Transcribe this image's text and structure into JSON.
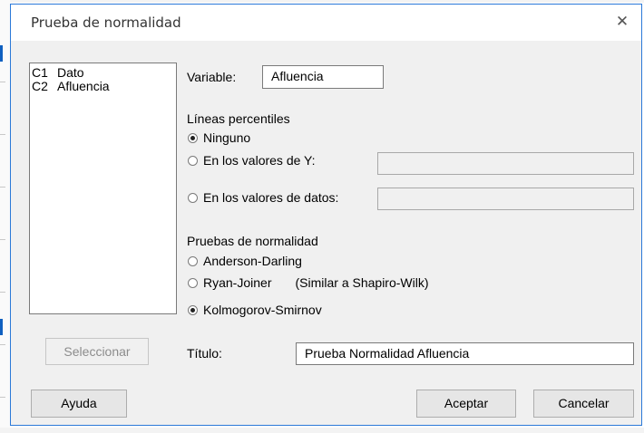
{
  "dialog": {
    "title": "Prueba de normalidad",
    "close_icon": "close-icon"
  },
  "variables": [
    {
      "id": "C1",
      "name": "Dato"
    },
    {
      "id": "C2",
      "name": "Afluencia"
    }
  ],
  "variable_field": {
    "label": "Variable:",
    "value": "Afluencia"
  },
  "percentile_lines": {
    "heading": "Líneas percentiles",
    "options": [
      {
        "label": "Ninguno",
        "selected": true
      },
      {
        "label": "En los valores de Y:",
        "selected": false
      },
      {
        "label": "En los valores de datos:",
        "selected": false
      }
    ],
    "y_values": "",
    "data_values": ""
  },
  "normality_tests": {
    "heading": "Pruebas de normalidad",
    "options": [
      {
        "label": "Anderson-Darling",
        "selected": false
      },
      {
        "label": "Ryan-Joiner",
        "note": "(Similar a Shapiro-Wilk)",
        "selected": false
      },
      {
        "label": "Kolmogorov-Smirnov",
        "selected": true
      }
    ]
  },
  "title_field": {
    "label": "Título:",
    "value": "Prueba Normalidad Afluencia"
  },
  "buttons": {
    "select": "Seleccionar",
    "help": "Ayuda",
    "ok": "Aceptar",
    "cancel": "Cancelar"
  }
}
